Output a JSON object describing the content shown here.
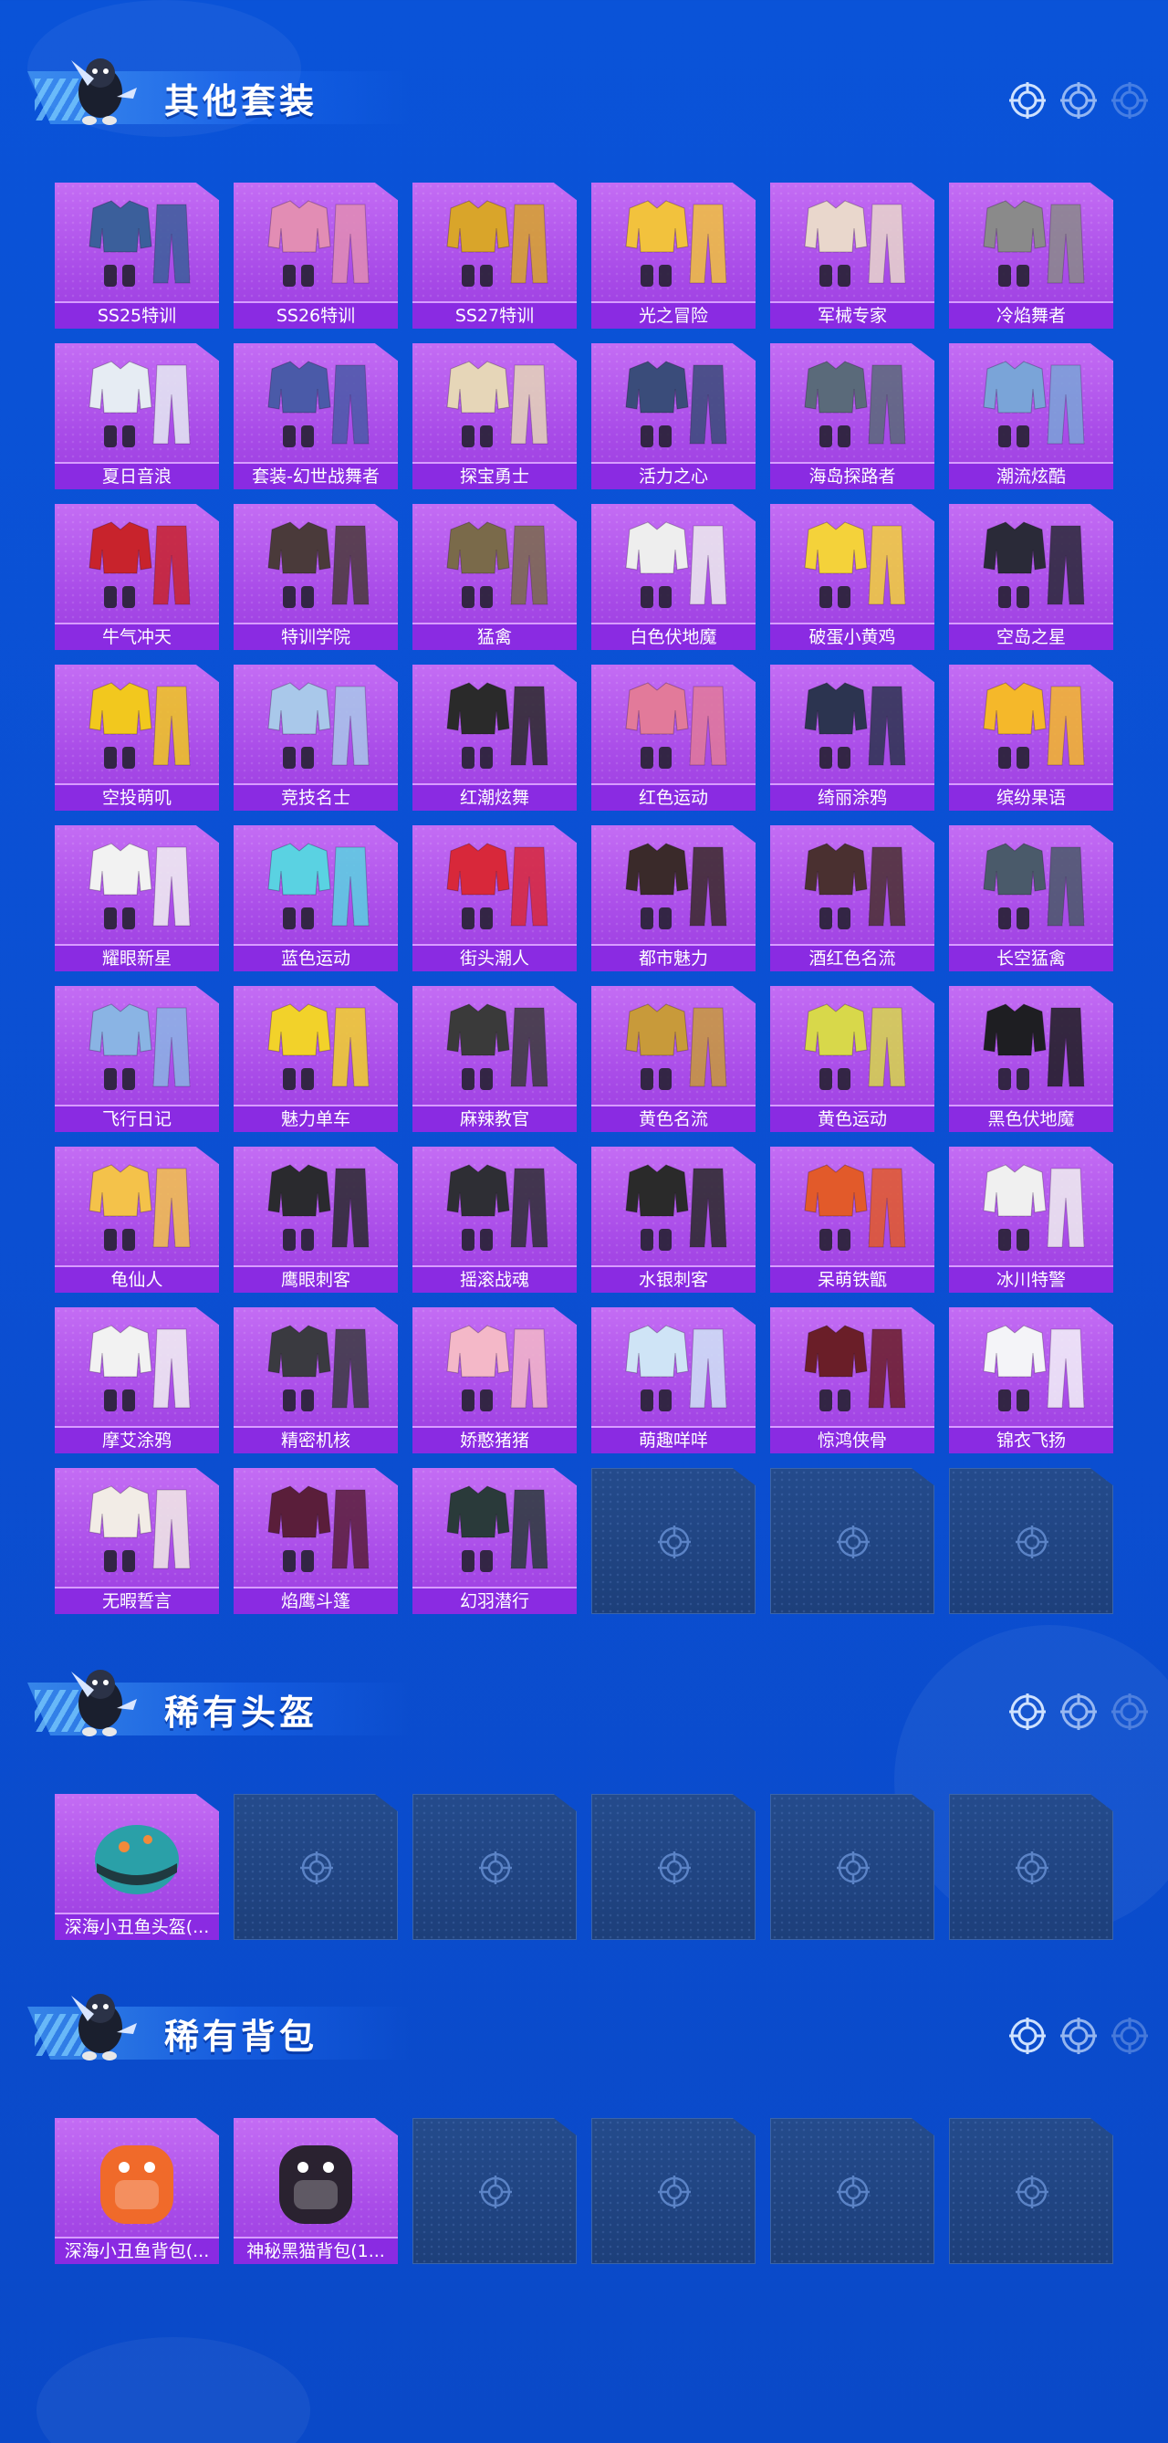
{
  "sections": [
    {
      "title": "其他套装",
      "items": [
        {
          "label": "SS25特训",
          "color": "#3b5f9b",
          "icon": "outfit-icon"
        },
        {
          "label": "SS26特训",
          "color": "#e28db4",
          "icon": "outfit-icon"
        },
        {
          "label": "SS27特训",
          "color": "#d9a52a",
          "icon": "outfit-icon"
        },
        {
          "label": "光之冒险",
          "color": "#f2c23d",
          "icon": "outfit-icon"
        },
        {
          "label": "军械专家",
          "color": "#e9d7cc",
          "icon": "outfit-icon"
        },
        {
          "label": "冷焰舞者",
          "color": "#8a8a8a",
          "icon": "outfit-icon"
        },
        {
          "label": "夏日音浪",
          "color": "#e6ecf3",
          "icon": "outfit-icon"
        },
        {
          "label": "套装-幻世战舞者",
          "color": "#4a5aa8",
          "icon": "outfit-icon"
        },
        {
          "label": "探宝勇士",
          "color": "#e6d6b8",
          "icon": "outfit-icon"
        },
        {
          "label": "活力之心",
          "color": "#3a4c7a",
          "icon": "outfit-icon"
        },
        {
          "label": "海岛探路者",
          "color": "#5a6a7a",
          "icon": "outfit-icon"
        },
        {
          "label": "潮流炫酷",
          "color": "#7aa4d8",
          "icon": "outfit-icon"
        },
        {
          "label": "牛气冲天",
          "color": "#c8232c",
          "icon": "outfit-icon"
        },
        {
          "label": "特训学院",
          "color": "#4a3a3a",
          "icon": "outfit-icon"
        },
        {
          "label": "猛禽",
          "color": "#7a6a4a",
          "icon": "outfit-icon"
        },
        {
          "label": "白色伏地魔",
          "color": "#eeeeee",
          "icon": "outfit-icon"
        },
        {
          "label": "破蛋小黄鸡",
          "color": "#f4d23a",
          "icon": "outfit-icon"
        },
        {
          "label": "空岛之星",
          "color": "#2a2a38",
          "icon": "outfit-icon"
        },
        {
          "label": "空投萌叽",
          "color": "#f2c81e",
          "icon": "outfit-icon"
        },
        {
          "label": "竞技名士",
          "color": "#a9c8ea",
          "icon": "outfit-icon"
        },
        {
          "label": "红潮炫舞",
          "color": "#2a2a2a",
          "icon": "outfit-icon"
        },
        {
          "label": "红色运动",
          "color": "#e27a9a",
          "icon": "outfit-icon"
        },
        {
          "label": "绮丽涂鸦",
          "color": "#2c3450",
          "icon": "outfit-icon"
        },
        {
          "label": "缤纷果语",
          "color": "#f5b82a",
          "icon": "outfit-icon"
        },
        {
          "label": "耀眼新星",
          "color": "#f2f2f2",
          "icon": "outfit-icon"
        },
        {
          "label": "蓝色运动",
          "color": "#5ad2e2",
          "icon": "outfit-icon"
        },
        {
          "label": "街头潮人",
          "color": "#d8283a",
          "icon": "outfit-icon"
        },
        {
          "label": "都市魅力",
          "color": "#3a2a2a",
          "icon": "outfit-icon"
        },
        {
          "label": "酒红色名流",
          "color": "#4a3030",
          "icon": "outfit-icon"
        },
        {
          "label": "长空猛禽",
          "color": "#4a5a6a",
          "icon": "outfit-icon"
        },
        {
          "label": "飞行日记",
          "color": "#8ab4e4",
          "icon": "outfit-icon"
        },
        {
          "label": "魅力单车",
          "color": "#f2d22a",
          "icon": "outfit-icon"
        },
        {
          "label": "麻辣教官",
          "color": "#3a3a3a",
          "icon": "outfit-icon"
        },
        {
          "label": "黄色名流",
          "color": "#c89a3a",
          "icon": "outfit-icon"
        },
        {
          "label": "黄色运动",
          "color": "#d8d84a",
          "icon": "outfit-icon"
        },
        {
          "label": "黑色伏地魔",
          "color": "#1e1e22",
          "icon": "outfit-icon"
        },
        {
          "label": "龟仙人",
          "color": "#f4c24a",
          "icon": "outfit-icon"
        },
        {
          "label": "鹰眼刺客",
          "color": "#2a2a2e",
          "icon": "outfit-icon"
        },
        {
          "label": "摇滚战魂",
          "color": "#2e2e34",
          "icon": "outfit-icon"
        },
        {
          "label": "水银刺客",
          "color": "#2a2a2a",
          "icon": "outfit-icon"
        },
        {
          "label": "呆萌铁甑",
          "color": "#e25a2a",
          "icon": "outfit-icon"
        },
        {
          "label": "冰川特警",
          "color": "#f0f0f0",
          "icon": "outfit-icon"
        },
        {
          "label": "摩艾涂鸦",
          "color": "#f2f2f2",
          "icon": "outfit-icon"
        },
        {
          "label": "精密机核",
          "color": "#3a3a40",
          "icon": "outfit-icon"
        },
        {
          "label": "娇憨猪猪",
          "color": "#f4b8c8",
          "icon": "outfit-icon"
        },
        {
          "label": "萌趣咩咩",
          "color": "#cfe4f6",
          "icon": "outfit-icon"
        },
        {
          "label": "惊鸿侠骨",
          "color": "#6a1e28",
          "icon": "outfit-icon"
        },
        {
          "label": "锦衣飞扬",
          "color": "#f4f4f8",
          "icon": "outfit-icon"
        },
        {
          "label": "无暇誓言",
          "color": "#f2ece6",
          "icon": "outfit-icon"
        },
        {
          "label": "焰鹰斗篷",
          "color": "#5a1e3a",
          "icon": "outfit-icon"
        },
        {
          "label": "幻羽潜行",
          "color": "#2a3a3a",
          "icon": "outfit-icon"
        }
      ],
      "empty_slots": 3
    },
    {
      "title": "稀有头盔",
      "items": [
        {
          "label": "深海小丑鱼头盔(...",
          "color": "#2aa0a8",
          "icon": "helmet-icon"
        }
      ],
      "empty_slots": 5
    },
    {
      "title": "稀有背包",
      "items": [
        {
          "label": "深海小丑鱼背包(...",
          "color": "#f06a2a",
          "icon": "backpack-icon"
        },
        {
          "label": "神秘黑猫背包(1...",
          "color": "#2a2230",
          "icon": "backpack-icon"
        }
      ],
      "empty_slots": 4
    }
  ]
}
